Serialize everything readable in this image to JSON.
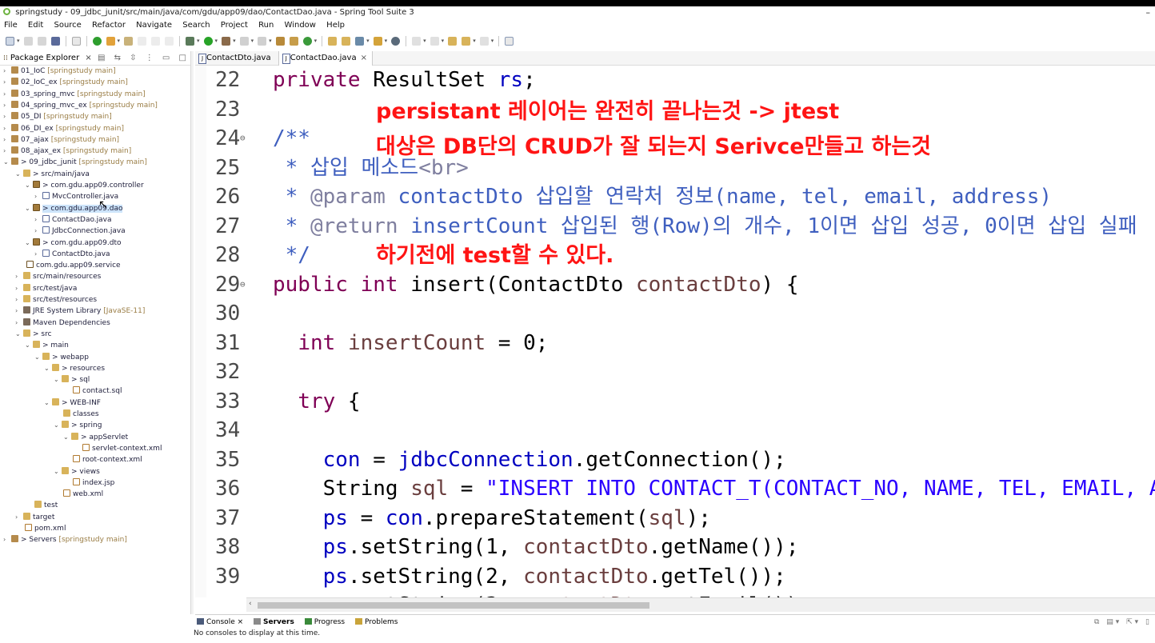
{
  "window": {
    "title": "springstudy - 09_jdbc_junit/src/main/java/com/gdu/app09/dao/ContactDao.java - Spring Tool Suite 3",
    "minimize_symbol": "–"
  },
  "menu": [
    "File",
    "Edit",
    "Source",
    "Refactor",
    "Navigate",
    "Search",
    "Project",
    "Run",
    "Window",
    "Help"
  ],
  "package_explorer": {
    "tab_label": "Package Explorer",
    "close_symbol": "×",
    "tree": [
      {
        "label": "01_IoC",
        "decoration": "[springstudy main]"
      },
      {
        "label": "02_IoC_ex",
        "decoration": "[springstudy main]"
      },
      {
        "label": "03_spring_mvc",
        "decoration": "[springstudy main]"
      },
      {
        "label": "04_spring_mvc_ex",
        "decoration": "[springstudy main]"
      },
      {
        "label": "05_DI",
        "decoration": "[springstudy main]"
      },
      {
        "label": "06_DI_ex",
        "decoration": "[springstudy main]"
      },
      {
        "label": "07_ajax",
        "decoration": "[springstudy main]"
      },
      {
        "label": "08_ajax_ex",
        "decoration": "[springstudy main]"
      },
      {
        "label": "> 09_jdbc_junit",
        "decoration": "[springstudy main]"
      },
      {
        "label": "> src/main/java",
        "decoration": ""
      },
      {
        "label": "> com.gdu.app09.controller",
        "decoration": ""
      },
      {
        "label": "MvcController.java",
        "decoration": ""
      },
      {
        "label": "> com.gdu.app09.dao",
        "decoration": ""
      },
      {
        "label": "ContactDao.java",
        "decoration": ""
      },
      {
        "label": "JdbcConnection.java",
        "decoration": ""
      },
      {
        "label": "> com.gdu.app09.dto",
        "decoration": ""
      },
      {
        "label": "ContactDto.java",
        "decoration": ""
      },
      {
        "label": "com.gdu.app09.service",
        "decoration": ""
      },
      {
        "label": "src/main/resources",
        "decoration": ""
      },
      {
        "label": "src/test/java",
        "decoration": ""
      },
      {
        "label": "src/test/resources",
        "decoration": ""
      },
      {
        "label": "JRE System Library",
        "decoration": "[JavaSE-11]"
      },
      {
        "label": "Maven Dependencies",
        "decoration": ""
      },
      {
        "label": "> src",
        "decoration": ""
      },
      {
        "label": "> main",
        "decoration": ""
      },
      {
        "label": "> webapp",
        "decoration": ""
      },
      {
        "label": "> resources",
        "decoration": ""
      },
      {
        "label": "> sql",
        "decoration": ""
      },
      {
        "label": "contact.sql",
        "decoration": ""
      },
      {
        "label": "> WEB-INF",
        "decoration": ""
      },
      {
        "label": "classes",
        "decoration": ""
      },
      {
        "label": "> spring",
        "decoration": ""
      },
      {
        "label": "> appServlet",
        "decoration": ""
      },
      {
        "label": "servlet-context.xml",
        "decoration": ""
      },
      {
        "label": "root-context.xml",
        "decoration": ""
      },
      {
        "label": "> views",
        "decoration": ""
      },
      {
        "label": "index.jsp",
        "decoration": ""
      },
      {
        "label": "web.xml",
        "decoration": ""
      },
      {
        "label": "test",
        "decoration": ""
      },
      {
        "label": "target",
        "decoration": ""
      },
      {
        "label": "pom.xml",
        "decoration": ""
      },
      {
        "label": "> Servers",
        "decoration": "[springstudy main]"
      }
    ]
  },
  "editor": {
    "tabs": [
      {
        "label": "ContactDto.java",
        "active": false
      },
      {
        "label": "ContactDao.java",
        "active": true
      }
    ],
    "close_symbol": "×",
    "line_numbers": [
      "22",
      "23",
      "24",
      "25",
      "26",
      "27",
      "28",
      "29",
      "30",
      "31",
      "32",
      "33",
      "34",
      "35",
      "36",
      "37",
      "38",
      "39"
    ],
    "annotations": [
      "persistant 레이어는 완전히 끝나는것 -> jtest",
      "대상은 DB단의 CRUD가 잘 되는지 Serivce만들고 하는것",
      "하기전에 test할 수 있다."
    ]
  },
  "bottom_panel": {
    "tabs": [
      "Console",
      "Servers",
      "Progress",
      "Problems"
    ],
    "close_symbol": "×",
    "message": "No consoles to display at this time."
  },
  "colors": {
    "keyword": "#7f0055",
    "field": "#0000c0",
    "local_variable": "#6a3e3e",
    "javadoc": "#3f5fbf",
    "string": "#2a00ff",
    "annotation_overlay": "#ff1414",
    "tree_selection": "#cde4fa"
  }
}
